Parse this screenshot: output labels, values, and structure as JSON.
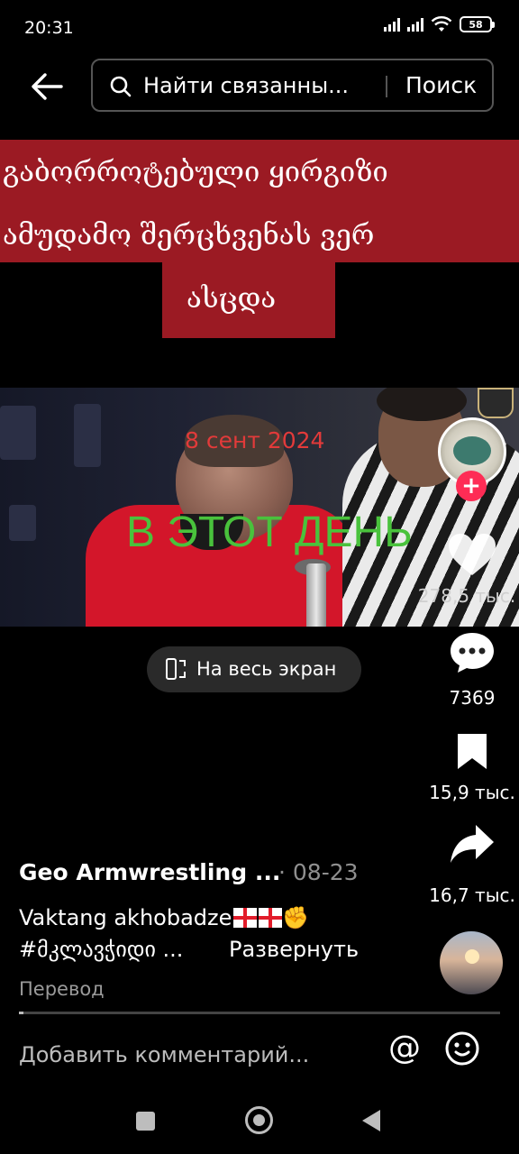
{
  "status_bar": {
    "time": "20:31",
    "battery": "58"
  },
  "search": {
    "placeholder": "Найти связанны...",
    "button_label": "Поиск"
  },
  "caption": {
    "line1": "გაბორროტებული ყირგიზი",
    "line2": "ამუდამო შერცხვენას ვერ",
    "line3": "ასცდა",
    "background_color": "#9b1a23"
  },
  "video": {
    "date_overlay": "8 сент 2024",
    "day_overlay": "В ЭТОТ ДЕНЬ",
    "date_color": "#e23a3a",
    "day_color": "#49c23c"
  },
  "actions": {
    "likes": "278,5 тыс.",
    "comments": "7369",
    "saves": "15,9 тыс.",
    "shares": "16,7 тыс.",
    "follow_color": "#fe2c55"
  },
  "fullscreen": {
    "label": "На весь экран"
  },
  "post": {
    "author": "Geo Armwrestling ...",
    "date": "· 08-23",
    "description": "Vaktang akhobadze",
    "hashtags": "#მკლავჭიდი ...",
    "expand_label": "Развернуть",
    "translate_label": "Перевод",
    "progress": 0.01
  },
  "comment": {
    "placeholder": "Добавить комментарий..."
  },
  "icons": [
    "back-arrow-icon",
    "search-icon",
    "heart-icon",
    "comment-icon",
    "bookmark-icon",
    "share-icon",
    "fullscreen-icon",
    "mention-icon",
    "emoji-icon"
  ]
}
